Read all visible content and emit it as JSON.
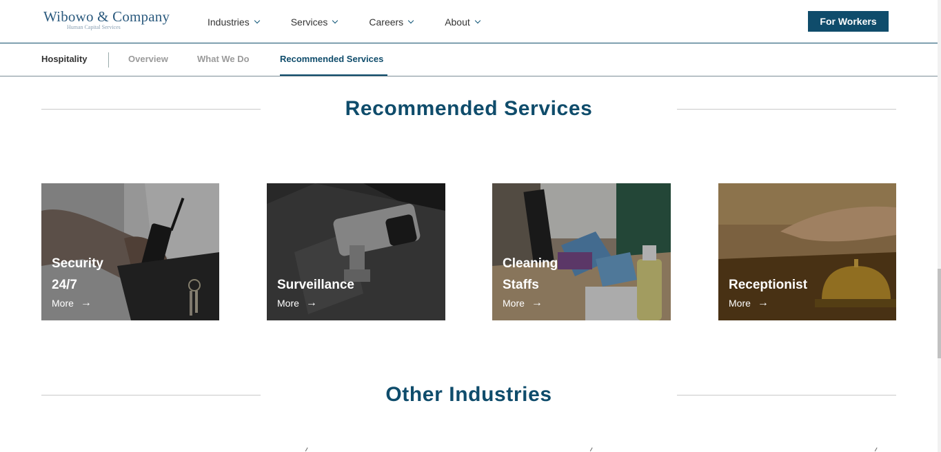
{
  "header": {
    "logo_name": "Wibowo & Company",
    "logo_subtitle": "Human Capital Services",
    "nav": [
      {
        "label": "Industries"
      },
      {
        "label": "Services"
      },
      {
        "label": "Careers"
      },
      {
        "label": "About"
      }
    ],
    "cta_label": "For Workers"
  },
  "subnav": {
    "current": "Hospitality",
    "items": [
      {
        "label": "Overview"
      },
      {
        "label": "What We Do"
      },
      {
        "label": "Recommended Services"
      }
    ],
    "active": "Recommended Services"
  },
  "recommended": {
    "title": "Recommended Services",
    "cards": [
      {
        "title_line1": "Security",
        "title_line2": "24/7",
        "more": "More"
      },
      {
        "title_line1": "Surveillance",
        "title_line2": "",
        "more": "More"
      },
      {
        "title_line1": "Cleaning",
        "title_line2": "Staffs",
        "more": "More"
      },
      {
        "title_line1": "Receptionist",
        "title_line2": "",
        "more": "More"
      }
    ]
  },
  "other": {
    "title": "Other Industries"
  },
  "colors": {
    "brand": "#0f4c6b",
    "section_line": "#c9c9c9"
  }
}
